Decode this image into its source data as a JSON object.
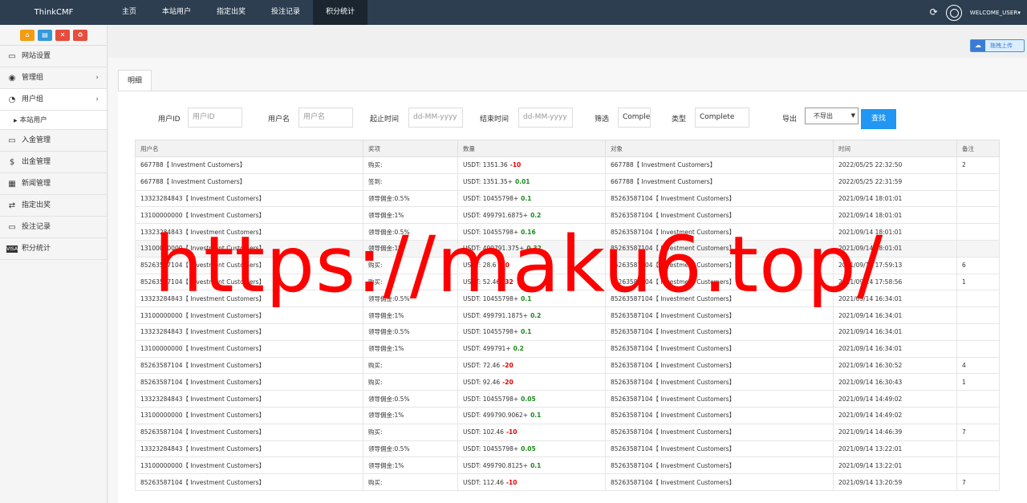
{
  "brand": "ThinkCMF",
  "nav": [
    "主页",
    "本站用户",
    "指定出奖",
    "投注记录",
    "积分统计"
  ],
  "nav_active_index": 4,
  "top_right": {
    "welcome": "WELCOME_USER▾"
  },
  "shortcuts": [
    {
      "icon": "home-icon",
      "glyph": "⌂",
      "color": "#f39c12"
    },
    {
      "icon": "file-icon",
      "glyph": "▤",
      "color": "#3498db"
    },
    {
      "icon": "trash-icon",
      "glyph": "🗑",
      "color": "#e74c3c"
    },
    {
      "icon": "recycle-icon",
      "glyph": "♻",
      "color": "#e74c3c"
    }
  ],
  "sidebar": {
    "items": [
      {
        "label": "网站设置",
        "icon": "monitor-icon"
      },
      {
        "label": "管理组",
        "icon": "user-circle-icon"
      },
      {
        "label": "用户组",
        "icon": "user-icon"
      },
      {
        "label": "入金管理",
        "icon": "monitor-icon"
      },
      {
        "label": "出金管理",
        "icon": "dollar-icon"
      },
      {
        "label": "新闻管理",
        "icon": "newspaper-icon"
      },
      {
        "label": "指定出奖",
        "icon": "exchange-icon"
      },
      {
        "label": "投注记录",
        "icon": "monitor-icon"
      },
      {
        "label": "积分统计",
        "icon": "visa-icon"
      }
    ],
    "sub_item": "本站用户"
  },
  "drag_upload": "拖拽上传",
  "tab": "明细",
  "filters": {
    "user_id_label": "用户ID",
    "user_id_placeholder": "用户ID",
    "username_label": "用户名",
    "username_placeholder": "用户名",
    "start_label": "起止时间",
    "start_placeholder": "dd-MM-yyyy",
    "end_label": "结束时间",
    "end_placeholder": "dd-MM-yyyy",
    "filter_label": "筛选",
    "filter_value": "Comple",
    "type_label": "类型",
    "type_value": "Complete",
    "export_label": "导出",
    "export_value": "不导出",
    "search_button": "查找"
  },
  "table": {
    "headers": [
      "用户名",
      "奖项",
      "数量",
      "对象",
      "时间",
      "备注"
    ],
    "rows": [
      {
        "user": "667788【 Investment Customers】",
        "item": "购买:",
        "amount": "USDT: 1351.36",
        "delta": "-10",
        "target": "667788【 Investment Customers】",
        "time": "2022/05/25 22:32:50",
        "note": "2"
      },
      {
        "user": "667788【 Investment Customers】",
        "item": "签到:",
        "amount": "USDT: 1351.35+",
        "delta": "0.01",
        "target": "667788【 Investment Customers】",
        "time": "2022/05/25 22:31:59",
        "note": ""
      },
      {
        "user": "13323284843【 Investment Customers】",
        "item": "领导佣金:0.5%",
        "amount": "USDT: 10455798+",
        "delta": "0.1",
        "target": "85263587104【 Investment Customers】",
        "time": "2021/09/14 18:01:01",
        "note": ""
      },
      {
        "user": "13100000000【 Investment Customers】",
        "item": "领导佣金:1%",
        "amount": "USDT: 499791.6875+",
        "delta": "0.2",
        "target": "85263587104【 Investment Customers】",
        "time": "2021/09/14 18:01:01",
        "note": ""
      },
      {
        "user": "13323284843【 Investment Customers】",
        "item": "领导佣金:0.5%",
        "amount": "USDT: 10455798+",
        "delta": "0.16",
        "target": "85263587104【 Investment Customers】",
        "time": "2021/09/14 18:01:01",
        "note": ""
      },
      {
        "user": "13100000000【 Investment Customers】",
        "item": "领导佣金:1%",
        "amount": "USDT: 499791.375+",
        "delta": "0.32",
        "target": "85263587104【 Investment Customers】",
        "time": "2021/09/14 18:01:01",
        "note": ""
      },
      {
        "user": "85263587104【 Investment Customers】",
        "item": "购买:",
        "amount": "USDT: 28.6",
        "delta": "-20",
        "target": "85263587104【 Investment Customers】",
        "time": "2021/09/14 17:59:13",
        "note": "6"
      },
      {
        "user": "85263587104【 Investment Customers】",
        "item": "购买:",
        "amount": "USDT: 52.46",
        "delta": "-32",
        "target": "85263587104【 Investment Customers】",
        "time": "2021/09/14 17:58:56",
        "note": "1"
      },
      {
        "user": "13323284843【 Investment Customers】",
        "item": "领导佣金:0.5%",
        "amount": "USDT: 10455798+",
        "delta": "0.1",
        "target": "85263587104【 Investment Customers】",
        "time": "2021/09/14 16:34:01",
        "note": ""
      },
      {
        "user": "13100000000【 Investment Customers】",
        "item": "领导佣金:1%",
        "amount": "USDT: 499791.1875+",
        "delta": "0.2",
        "target": "85263587104【 Investment Customers】",
        "time": "2021/09/14 16:34:01",
        "note": ""
      },
      {
        "user": "13323284843【 Investment Customers】",
        "item": "领导佣金:0.5%",
        "amount": "USDT: 10455798+",
        "delta": "0.1",
        "target": "85263587104【 Investment Customers】",
        "time": "2021/09/14 16:34:01",
        "note": ""
      },
      {
        "user": "13100000000【 Investment Customers】",
        "item": "领导佣金:1%",
        "amount": "USDT: 499791+",
        "delta": "0.2",
        "target": "85263587104【 Investment Customers】",
        "time": "2021/09/14 16:34:01",
        "note": ""
      },
      {
        "user": "85263587104【 Investment Customers】",
        "item": "购买:",
        "amount": "USDT: 72.46",
        "delta": "-20",
        "target": "85263587104【 Investment Customers】",
        "time": "2021/09/14 16:30:52",
        "note": "4"
      },
      {
        "user": "85263587104【 Investment Customers】",
        "item": "购买:",
        "amount": "USDT: 92.46",
        "delta": "-20",
        "target": "85263587104【 Investment Customers】",
        "time": "2021/09/14 16:30:43",
        "note": "1"
      },
      {
        "user": "13323284843【 Investment Customers】",
        "item": "领导佣金:0.5%",
        "amount": "USDT: 10455798+",
        "delta": "0.05",
        "target": "85263587104【 Investment Customers】",
        "time": "2021/09/14 14:49:02",
        "note": ""
      },
      {
        "user": "13100000000【 Investment Customers】",
        "item": "领导佣金:1%",
        "amount": "USDT: 499790.9062+",
        "delta": "0.1",
        "target": "85263587104【 Investment Customers】",
        "time": "2021/09/14 14:49:02",
        "note": ""
      },
      {
        "user": "85263587104【 Investment Customers】",
        "item": "购买:",
        "amount": "USDT: 102.46",
        "delta": "-10",
        "target": "85263587104【 Investment Customers】",
        "time": "2021/09/14 14:46:39",
        "note": "7"
      },
      {
        "user": "13323284843【 Investment Customers】",
        "item": "领导佣金:0.5%",
        "amount": "USDT: 10455798+",
        "delta": "0.05",
        "target": "85263587104【 Investment Customers】",
        "time": "2021/09/14 13:22:01",
        "note": ""
      },
      {
        "user": "13100000000【 Investment Customers】",
        "item": "领导佣金:1%",
        "amount": "USDT: 499790.8125+",
        "delta": "0.1",
        "target": "85263587104【 Investment Customers】",
        "time": "2021/09/14 13:22:01",
        "note": ""
      },
      {
        "user": "85263587104【 Investment Customers】",
        "item": "购买:",
        "amount": "USDT: 112.46",
        "delta": "-10",
        "target": "85263587104【 Investment Customers】",
        "time": "2021/09/14 13:20:59",
        "note": "7"
      }
    ]
  },
  "watermark": "https://maku6.top/"
}
